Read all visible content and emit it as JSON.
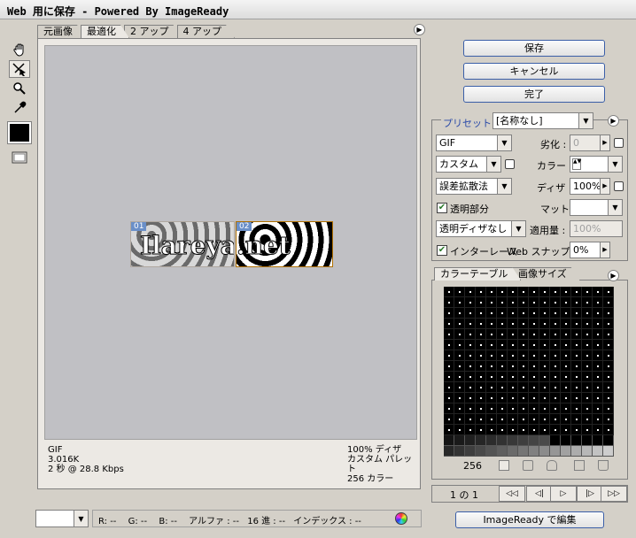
{
  "window": {
    "title": "Web 用に保存 - Powered By ImageReady"
  },
  "tabs": [
    "元画像",
    "最適化",
    "2 アップ",
    "4 アップ"
  ],
  "tab_menu_icon": "circle-arrow-right",
  "image": {
    "text": "Ilareya.net",
    "slice1": "01",
    "slice2": "02"
  },
  "info": {
    "format": "GIF",
    "size": "3.016K",
    "time": "2 秒 @ 28.8 Kbps",
    "dither": "100% ディザ",
    "palette": "カスタム パレット",
    "colors": "256 カラー"
  },
  "buttons": {
    "save": "保存",
    "cancel": "キャンセル",
    "done": "完了",
    "edit_imageready": "ImageReady で編集"
  },
  "settings": {
    "preset_label": "プリセット :",
    "preset_value": "[名称なし]",
    "format": "GIF",
    "lossy_label": "劣化 :",
    "lossy_value": "0",
    "palette": "カスタム",
    "colors_label": "カラー :",
    "dither_algo": "誤差拡散法",
    "dither_label": "ディザ :",
    "dither_value": "100%",
    "transparency_label": "透明部分",
    "transparency_checked": true,
    "matte_label": "マット :",
    "trans_dither": "透明ディザなし",
    "amount_label": "適用量 :",
    "amount_value": "100%",
    "interlaced_label": "インターレース",
    "interlaced_checked": true,
    "websnap_label": "Web スナップ :",
    "websnap_value": "0%"
  },
  "color_table": {
    "tab1": "カラーテーブル",
    "tab2": "画像サイズ",
    "count": "256"
  },
  "navigation": {
    "page": "1 の 1",
    "first": "◁◁",
    "prev": "◁|",
    "play": "▷",
    "next": "|▷",
    "last": "▷▷"
  },
  "readouts": {
    "r_label": "R:",
    "r": "--",
    "g_label": "G:",
    "g": "--",
    "b_label": "B:",
    "b": "--",
    "alpha_label": "アルファ :",
    "alpha": "--",
    "hex_label": "16 進 :",
    "hex": "--",
    "index_label": "インデックス :",
    "index": "--"
  },
  "zoom_value": ""
}
